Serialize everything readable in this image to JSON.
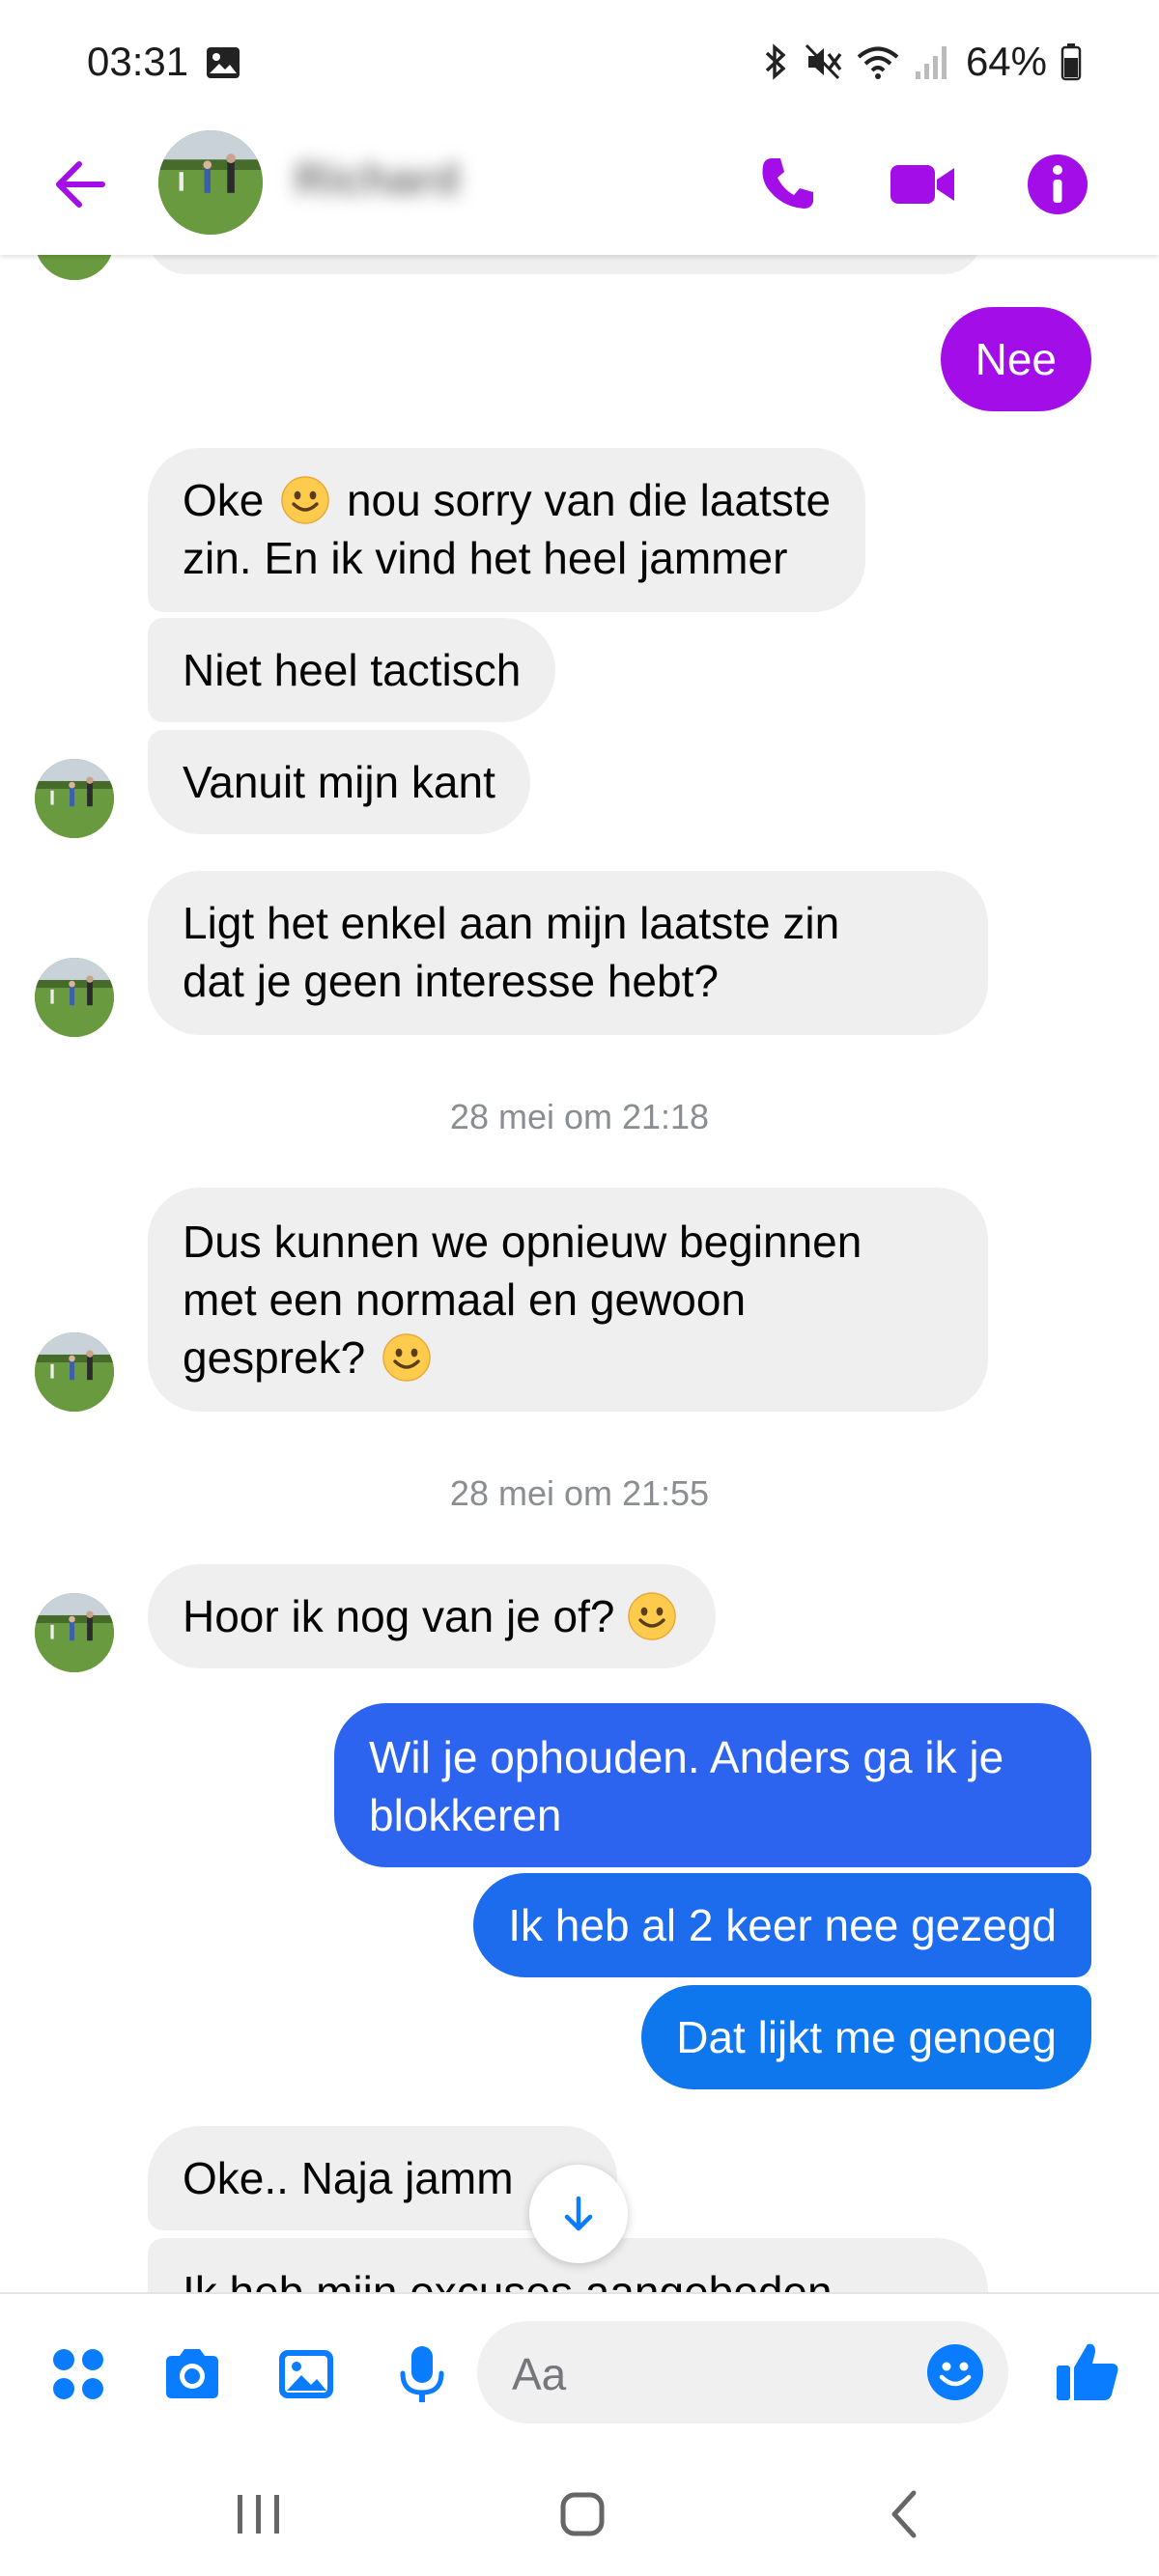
{
  "status_bar": {
    "time": "03:31",
    "battery": "64%"
  },
  "header": {
    "contact_name": "Richard",
    "accent_color": "#a30ee8"
  },
  "messages": [
    {
      "sender": "me",
      "text": "Nee"
    },
    {
      "sender": "contact",
      "text_before_emoji": "Oke",
      "emoji": "slightly-smiling-face",
      "text_after_emoji": "nou sorry van die laatste",
      "line2": "zin. En ik vind het heel jammer"
    },
    {
      "sender": "contact",
      "text": "Niet heel tactisch"
    },
    {
      "sender": "contact",
      "text": "Vanuit mijn kant"
    },
    {
      "sender": "contact",
      "line1": "Ligt het enkel aan mijn laatste zin",
      "line2": "dat je geen interesse hebt?"
    },
    {
      "sender": "contact",
      "line1": "Dus kunnen we opnieuw beginnen",
      "line2": "met een normaal en gewoon",
      "line3": "gesprek?",
      "emoji": "slightly-smiling-face"
    },
    {
      "sender": "contact",
      "text": "Hoor ik nog van je of?",
      "emoji": "slightly-smiling-face"
    },
    {
      "sender": "me",
      "line1": "Wil je ophouden. Anders ga ik je",
      "line2": "blokkeren"
    },
    {
      "sender": "me",
      "text": "Ik heb al 2 keer nee gezegd"
    },
    {
      "sender": "me",
      "text": "Dat lijkt me genoeg"
    },
    {
      "sender": "contact",
      "text": "Oke.. Naja jamm"
    },
    {
      "sender": "contact",
      "text": "Ik heb mijn excuses aangeboden"
    }
  ],
  "timestamps": [
    "28 mei om 21:18",
    "28 mei om 21:55"
  ],
  "composer": {
    "placeholder": "Aa"
  },
  "colors": {
    "outgoing_purple": "#a30ee8",
    "outgoing_blue": "#2c64f0",
    "outgoing_blue_light": "#0e77ee",
    "incoming_gray": "#efefef",
    "composer_icons": "#0a7cff"
  }
}
